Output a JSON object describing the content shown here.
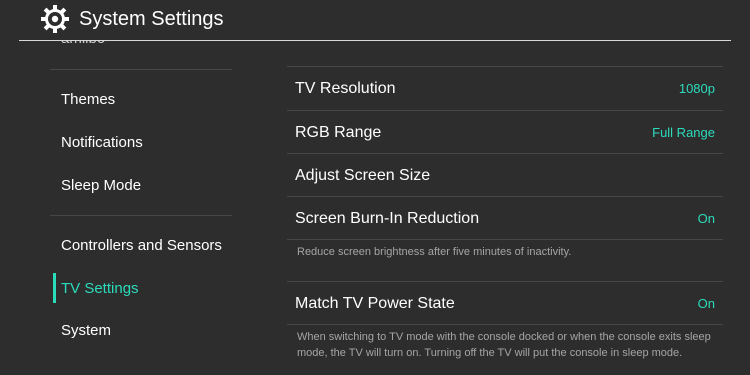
{
  "header": {
    "title": "System Settings",
    "icon": "gear-icon"
  },
  "sidebar": {
    "clipped_item": "amiibo",
    "items": [
      {
        "label": "Themes"
      },
      {
        "label": "Notifications"
      },
      {
        "label": "Sleep Mode"
      },
      {
        "label": "Controllers and Sensors"
      },
      {
        "label": "TV Settings",
        "selected": true
      },
      {
        "label": "System"
      }
    ]
  },
  "main": {
    "rows": [
      {
        "label": "TV Resolution",
        "value": "1080p"
      },
      {
        "label": "RGB Range",
        "value": "Full Range"
      },
      {
        "label": "Adjust Screen Size",
        "value": ""
      },
      {
        "label": "Screen Burn-In Reduction",
        "value": "On"
      },
      {
        "label": "Match TV Power State",
        "value": "On"
      }
    ],
    "burnin_desc": "Reduce screen brightness after five minutes of inactivity.",
    "power_desc": "When switching to TV mode with the console docked or when the console exits sleep mode, the TV will turn on. Turning off the TV will put the console in sleep mode."
  },
  "colors": {
    "accent": "#2bdcbc",
    "background": "#2d2d2d",
    "divider": "#474747",
    "description_text": "#a5a5a5"
  }
}
